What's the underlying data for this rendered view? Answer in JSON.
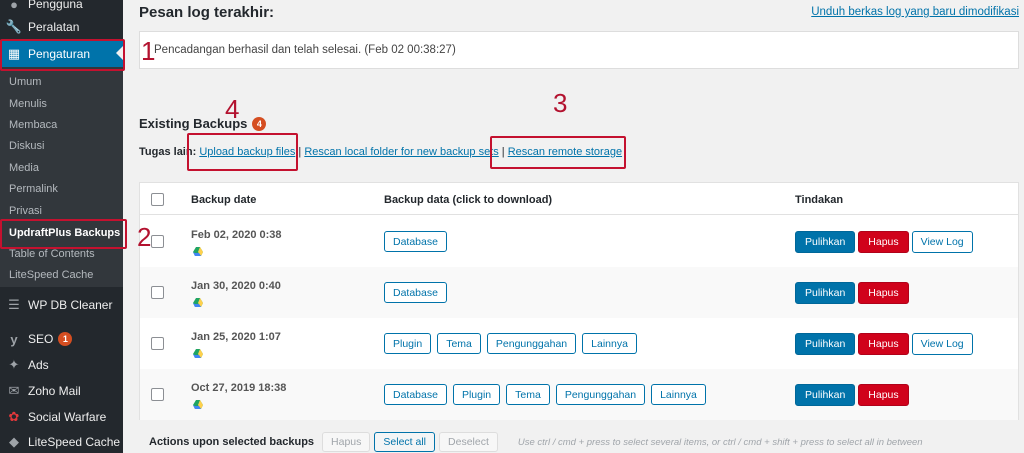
{
  "sidebar": {
    "top_items": [
      {
        "label": "Pengguna",
        "icon": "user-icon"
      },
      {
        "label": "Peralatan",
        "icon": "wrench-icon"
      },
      {
        "label": "Pengaturan",
        "icon": "settings-icon"
      }
    ],
    "submenu": [
      "Umum",
      "Menulis",
      "Membaca",
      "Diskusi",
      "Media",
      "Permalink",
      "Privasi",
      "UpdraftPlus Backups",
      "Table of Contents",
      "LiteSpeed Cache"
    ],
    "bottom_items": [
      {
        "label": "WP DB Cleaner",
        "icon": "database-icon"
      },
      {
        "label": "SEO",
        "icon": "seo-icon",
        "badge": "1"
      },
      {
        "label": "Ads",
        "icon": "pin-icon"
      },
      {
        "label": "Zoho Mail",
        "icon": "mail-icon"
      },
      {
        "label": "Social Warfare",
        "icon": "social-icon"
      },
      {
        "label": "LiteSpeed Cache",
        "icon": "diamond-icon"
      }
    ]
  },
  "annotations": [
    "1",
    "2",
    "3",
    "4"
  ],
  "log": {
    "heading": "Pesan log terakhir:",
    "download_link": "Unduh berkas log yang baru dimodifikasi",
    "message": "Pencadangan berhasil dan telah selesai. (Feb 02 00:38:27)"
  },
  "existing": {
    "heading": "Existing Backups",
    "count": "4",
    "tasks_label": "Tugas lain:",
    "task_links": [
      "Upload backup files",
      "Rescan local folder for new backup sets",
      "Rescan remote storage"
    ]
  },
  "table": {
    "headers": [
      "Backup date",
      "Backup data (click to download)",
      "Tindakan"
    ],
    "rows": [
      {
        "date": "Feb 02, 2020 0:38",
        "data": [
          "Database"
        ],
        "actions": [
          "Pulihkan",
          "Hapus",
          "View Log"
        ]
      },
      {
        "date": "Jan 30, 2020 0:40",
        "data": [
          "Database"
        ],
        "actions": [
          "Pulihkan",
          "Hapus"
        ]
      },
      {
        "date": "Jan 25, 2020 1:07",
        "data": [
          "Plugin",
          "Tema",
          "Pengunggahan",
          "Lainnya"
        ],
        "actions": [
          "Pulihkan",
          "Hapus",
          "View Log"
        ]
      },
      {
        "date": "Oct 27, 2019 18:38",
        "data": [
          "Database",
          "Plugin",
          "Tema",
          "Pengunggahan",
          "Lainnya"
        ],
        "actions": [
          "Pulihkan",
          "Hapus"
        ]
      }
    ]
  },
  "footer": {
    "label": "Actions upon selected backups",
    "buttons": [
      "Hapus",
      "Select all",
      "Deselect"
    ],
    "hint": "Use ctrl / cmd + press to select several items, or ctrl / cmd + shift + press to select all in between"
  },
  "colors": {
    "accent": "#0073aa",
    "danger": "#d0021b",
    "annotation": "#c4112f",
    "sidebar": "#23282d"
  }
}
